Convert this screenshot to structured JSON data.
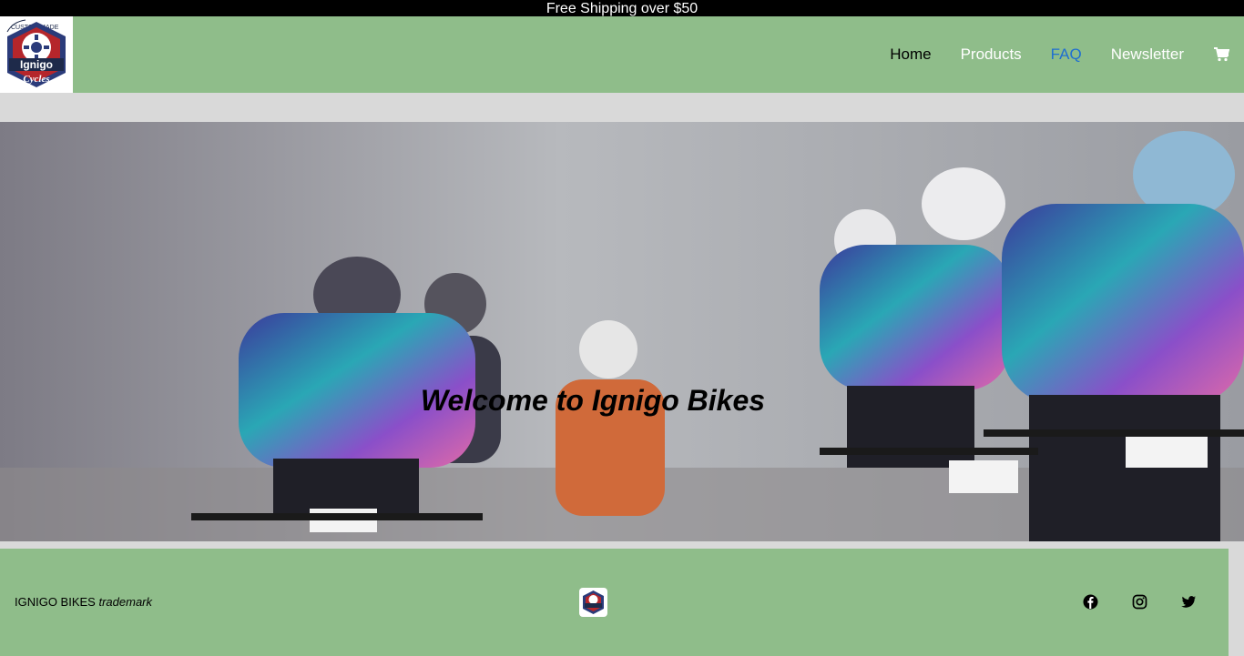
{
  "announcement": "Free Shipping over $50",
  "brand": {
    "logo_top": "CUSTOM MADE",
    "logo_name": "Ignigo",
    "logo_script": "Cycles"
  },
  "nav": {
    "home": "Home",
    "products": "Products",
    "faq": "FAQ",
    "newsletter": "Newsletter",
    "cart_icon": "shopping-cart-icon"
  },
  "hero": {
    "title": "Welcome to Ignigo Bikes"
  },
  "footer": {
    "brand_name": "IGNIGO BIKES",
    "brand_tag": "trademark",
    "social_icons": [
      "facebook-icon",
      "instagram-icon",
      "twitter-icon"
    ]
  },
  "colors": {
    "accent_green": "#8fbd8a",
    "link_blue": "#1f6fd1",
    "topbar": "#000000"
  }
}
